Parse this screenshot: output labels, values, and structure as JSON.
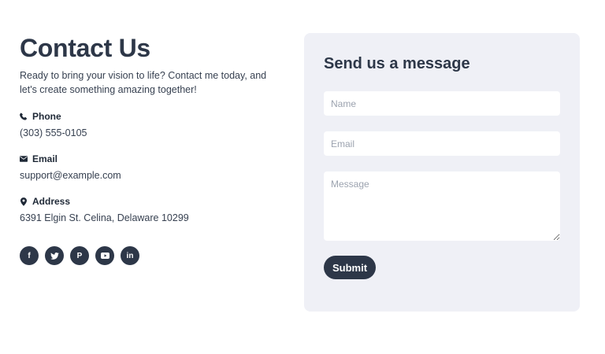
{
  "contact": {
    "title": "Contact Us",
    "intro": "Ready to bring your vision to life? Contact me today, and let's create something amazing together!",
    "phone_label": "Phone",
    "phone_value": "(303) 555-0105",
    "email_label": "Email",
    "email_value": "support@example.com",
    "address_label": "Address",
    "address_value": "6391 Elgin St. Celina, Delaware 10299",
    "socials": [
      {
        "name": "facebook-icon",
        "glyph": "f"
      },
      {
        "name": "twitter-icon",
        "glyph": "🐦"
      },
      {
        "name": "pinterest-icon",
        "glyph": "P"
      },
      {
        "name": "youtube-icon",
        "glyph": "▶"
      },
      {
        "name": "linkedin-icon",
        "glyph": "in"
      }
    ]
  },
  "form": {
    "title": "Send us a message",
    "name_placeholder": "Name",
    "email_placeholder": "Email",
    "message_placeholder": "Message",
    "submit_label": "Submit"
  },
  "colors": {
    "accent": "#2d3748",
    "card_background": "#eff0f6"
  }
}
